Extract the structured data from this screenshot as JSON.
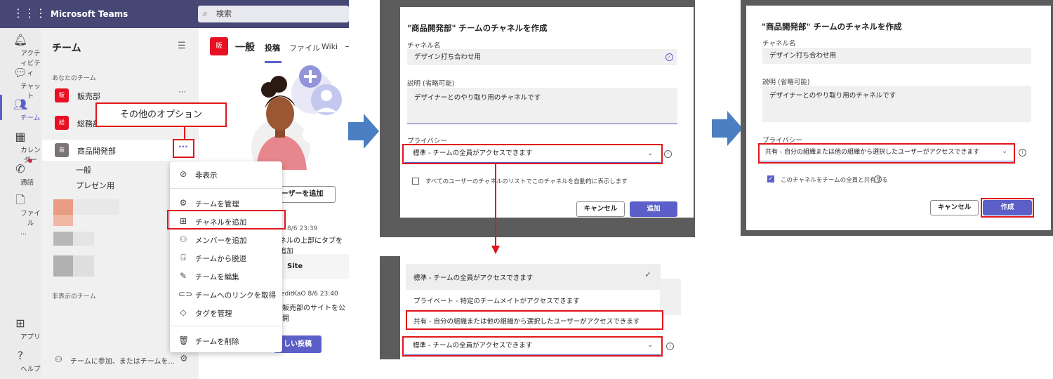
{
  "teams_app": {
    "title": "Microsoft Teams",
    "search_placeholder": "検索",
    "rail": [
      {
        "label": "アクティビティ",
        "icon": "bell-icon"
      },
      {
        "label": "チャット",
        "icon": "chat-icon"
      },
      {
        "label": "チーム",
        "icon": "teams-icon"
      },
      {
        "label": "カレンダー",
        "icon": "calendar-icon"
      },
      {
        "label": "通話",
        "icon": "phone-icon"
      },
      {
        "label": "ファイル",
        "icon": "file-icon"
      },
      {
        "label": "...",
        "icon": "more-icon"
      },
      {
        "label": "アプリ",
        "icon": "apps-icon"
      },
      {
        "label": "ヘルプ",
        "icon": "help-icon"
      }
    ],
    "teams_header": "チーム",
    "your_teams_label": "あなたのチーム",
    "team_list": [
      {
        "tile": "販",
        "name": "販売部",
        "color": "#e81123",
        "more": "···"
      },
      {
        "tile": "総",
        "name": "総務部",
        "color": "#e81123"
      },
      {
        "tile": "商",
        "name": "商品開発部",
        "color": "#7a7574",
        "more": "···"
      }
    ],
    "channels": [
      "一般",
      "プレゼン用"
    ],
    "hidden_teams_label": "非表示のチーム",
    "join_text": "チームに参加、またはチームを...",
    "callout": "その他のオプション",
    "channel_header": {
      "tile": "販",
      "name": "一般",
      "tabs": [
        "投稿",
        "ファイル",
        "Wiki"
      ]
    },
    "add_user_button": "ーザーを追加",
    "msg1_time": "8/6 23:39",
    "msg1_text": "ネルの上部にタブを追加",
    "site_label": "Site",
    "msg2_time": "editKaO  8/6 23:40",
    "msg2_text": "販売部のサイトを公開",
    "new_post_button": "しい投稿",
    "context_menu": [
      {
        "label": "非表示",
        "icon": "hide-icon"
      },
      {
        "label": "チームを管理",
        "icon": "settings-icon"
      },
      {
        "label": "チャネルを追加",
        "icon": "add-channel-icon"
      },
      {
        "label": "メンバーを追加",
        "icon": "add-member-icon"
      },
      {
        "label": "チームから脱退",
        "icon": "leave-icon"
      },
      {
        "label": "チームを編集",
        "icon": "edit-icon"
      },
      {
        "label": "チームへのリンクを取得",
        "icon": "link-icon"
      },
      {
        "label": "タグを管理",
        "icon": "tag-icon"
      },
      {
        "label": "チームを削除",
        "icon": "trash-icon"
      }
    ]
  },
  "dialog1": {
    "title": "\"商品開発部\" チームのチャネルを作成",
    "name_label": "チャネル名",
    "name_value": "デザイン打ち合わせ用",
    "desc_label": "説明 (省略可能)",
    "desc_value": "デザイナーとのやり取り用のチャネルです",
    "privacy_label": "プライバシー",
    "privacy_value": "標準 - チームの全員がアクセスできます",
    "checkbox_label": "すべてのユーザーのチャネルのリストでこのチャネルを自動的に表示します",
    "cancel": "キャンセル",
    "add": "追加"
  },
  "dropdown": {
    "options": [
      "標準 - チームの全員がアクセスできます",
      "プライベート - 特定のチームメイトがアクセスできます",
      "共有 - 自分の組織または他の組織から選択したユーザーがアクセスできます"
    ],
    "selected": "標準 - チームの全員がアクセスできます"
  },
  "dialog2": {
    "title": "\"商品開発部\" チームのチャネルを作成",
    "name_label": "チャネル名",
    "name_value": "デザイン打ち合わせ用",
    "desc_label": "説明 (省略可能)",
    "desc_value": "デザイナーとのやり取り用のチャネルです",
    "privacy_label": "プライバシー",
    "privacy_value": "共有 - 自分の組織または他の組織から選択したユーザーがアクセスできます",
    "checkbox_label": "このチャネルをチームの全員と共有する",
    "cancel": "キャンセル",
    "create": "作成"
  },
  "colors": {
    "accent": "#5b5fc7",
    "highlight": "#e0161c",
    "titlebar": "#464775",
    "arrow": "#4a7fc1"
  }
}
